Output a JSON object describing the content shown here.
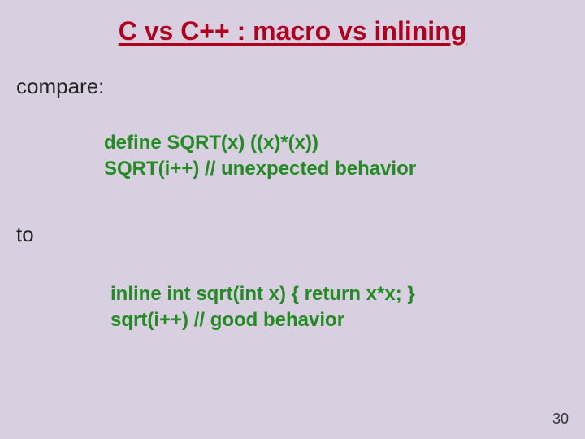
{
  "title": "C vs C++ : macro vs inlining",
  "label_compare": "compare:",
  "code1": {
    "line1": "define SQRT(x) ((x)*(x))",
    "line2": "SQRT(i++) // unexpected behavior"
  },
  "label_to": "to",
  "code2": {
    "line1": "inline int sqrt(int x) { return x*x; }",
    "line2": "sqrt(i++) // good behavior"
  },
  "page_number": "30"
}
